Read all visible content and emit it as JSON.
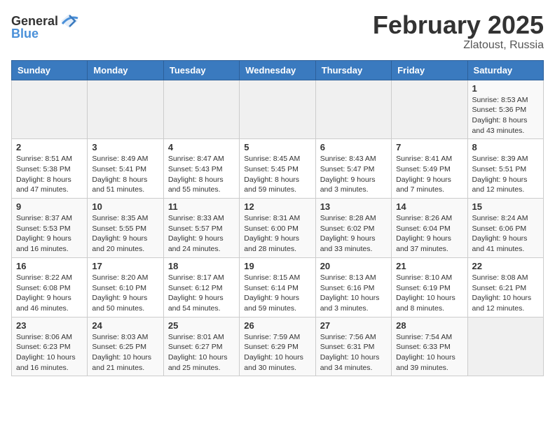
{
  "header": {
    "logo_general": "General",
    "logo_blue": "Blue",
    "month_year": "February 2025",
    "location": "Zlatoust, Russia"
  },
  "weekdays": [
    "Sunday",
    "Monday",
    "Tuesday",
    "Wednesday",
    "Thursday",
    "Friday",
    "Saturday"
  ],
  "weeks": [
    [
      {
        "day": "",
        "info": ""
      },
      {
        "day": "",
        "info": ""
      },
      {
        "day": "",
        "info": ""
      },
      {
        "day": "",
        "info": ""
      },
      {
        "day": "",
        "info": ""
      },
      {
        "day": "",
        "info": ""
      },
      {
        "day": "1",
        "info": "Sunrise: 8:53 AM\nSunset: 5:36 PM\nDaylight: 8 hours and 43 minutes."
      }
    ],
    [
      {
        "day": "2",
        "info": "Sunrise: 8:51 AM\nSunset: 5:38 PM\nDaylight: 8 hours and 47 minutes."
      },
      {
        "day": "3",
        "info": "Sunrise: 8:49 AM\nSunset: 5:41 PM\nDaylight: 8 hours and 51 minutes."
      },
      {
        "day": "4",
        "info": "Sunrise: 8:47 AM\nSunset: 5:43 PM\nDaylight: 8 hours and 55 minutes."
      },
      {
        "day": "5",
        "info": "Sunrise: 8:45 AM\nSunset: 5:45 PM\nDaylight: 8 hours and 59 minutes."
      },
      {
        "day": "6",
        "info": "Sunrise: 8:43 AM\nSunset: 5:47 PM\nDaylight: 9 hours and 3 minutes."
      },
      {
        "day": "7",
        "info": "Sunrise: 8:41 AM\nSunset: 5:49 PM\nDaylight: 9 hours and 7 minutes."
      },
      {
        "day": "8",
        "info": "Sunrise: 8:39 AM\nSunset: 5:51 PM\nDaylight: 9 hours and 12 minutes."
      }
    ],
    [
      {
        "day": "9",
        "info": "Sunrise: 8:37 AM\nSunset: 5:53 PM\nDaylight: 9 hours and 16 minutes."
      },
      {
        "day": "10",
        "info": "Sunrise: 8:35 AM\nSunset: 5:55 PM\nDaylight: 9 hours and 20 minutes."
      },
      {
        "day": "11",
        "info": "Sunrise: 8:33 AM\nSunset: 5:57 PM\nDaylight: 9 hours and 24 minutes."
      },
      {
        "day": "12",
        "info": "Sunrise: 8:31 AM\nSunset: 6:00 PM\nDaylight: 9 hours and 28 minutes."
      },
      {
        "day": "13",
        "info": "Sunrise: 8:28 AM\nSunset: 6:02 PM\nDaylight: 9 hours and 33 minutes."
      },
      {
        "day": "14",
        "info": "Sunrise: 8:26 AM\nSunset: 6:04 PM\nDaylight: 9 hours and 37 minutes."
      },
      {
        "day": "15",
        "info": "Sunrise: 8:24 AM\nSunset: 6:06 PM\nDaylight: 9 hours and 41 minutes."
      }
    ],
    [
      {
        "day": "16",
        "info": "Sunrise: 8:22 AM\nSunset: 6:08 PM\nDaylight: 9 hours and 46 minutes."
      },
      {
        "day": "17",
        "info": "Sunrise: 8:20 AM\nSunset: 6:10 PM\nDaylight: 9 hours and 50 minutes."
      },
      {
        "day": "18",
        "info": "Sunrise: 8:17 AM\nSunset: 6:12 PM\nDaylight: 9 hours and 54 minutes."
      },
      {
        "day": "19",
        "info": "Sunrise: 8:15 AM\nSunset: 6:14 PM\nDaylight: 9 hours and 59 minutes."
      },
      {
        "day": "20",
        "info": "Sunrise: 8:13 AM\nSunset: 6:16 PM\nDaylight: 10 hours and 3 minutes."
      },
      {
        "day": "21",
        "info": "Sunrise: 8:10 AM\nSunset: 6:19 PM\nDaylight: 10 hours and 8 minutes."
      },
      {
        "day": "22",
        "info": "Sunrise: 8:08 AM\nSunset: 6:21 PM\nDaylight: 10 hours and 12 minutes."
      }
    ],
    [
      {
        "day": "23",
        "info": "Sunrise: 8:06 AM\nSunset: 6:23 PM\nDaylight: 10 hours and 16 minutes."
      },
      {
        "day": "24",
        "info": "Sunrise: 8:03 AM\nSunset: 6:25 PM\nDaylight: 10 hours and 21 minutes."
      },
      {
        "day": "25",
        "info": "Sunrise: 8:01 AM\nSunset: 6:27 PM\nDaylight: 10 hours and 25 minutes."
      },
      {
        "day": "26",
        "info": "Sunrise: 7:59 AM\nSunset: 6:29 PM\nDaylight: 10 hours and 30 minutes."
      },
      {
        "day": "27",
        "info": "Sunrise: 7:56 AM\nSunset: 6:31 PM\nDaylight: 10 hours and 34 minutes."
      },
      {
        "day": "28",
        "info": "Sunrise: 7:54 AM\nSunset: 6:33 PM\nDaylight: 10 hours and 39 minutes."
      },
      {
        "day": "",
        "info": ""
      }
    ]
  ]
}
